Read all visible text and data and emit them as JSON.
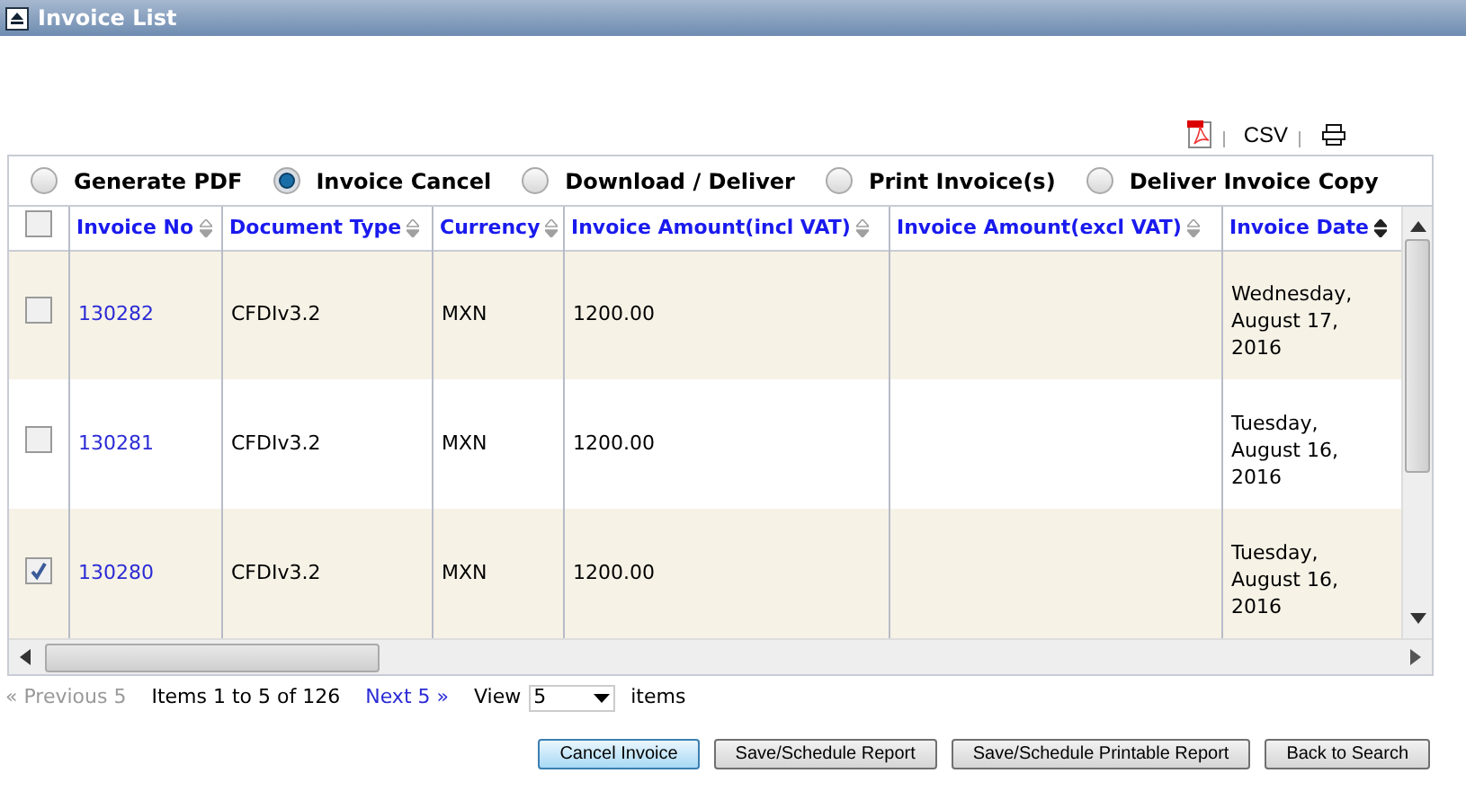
{
  "window": {
    "title": "Invoice List"
  },
  "export": [
    "CSV"
  ],
  "actions": [
    {
      "label": "Generate PDF",
      "selected": false
    },
    {
      "label": "Invoice Cancel",
      "selected": true
    },
    {
      "label": "Download / Deliver",
      "selected": false
    },
    {
      "label": "Print Invoice(s)",
      "selected": false
    },
    {
      "label": "Deliver Invoice Copy",
      "selected": false
    }
  ],
  "table": {
    "select_all": {
      "checked": false
    },
    "columns": [
      {
        "label": "Invoice No",
        "sorted": false
      },
      {
        "label": "Document Type",
        "sorted": false
      },
      {
        "label": "Currency",
        "sorted": false
      },
      {
        "label": "Invoice Amount(incl VAT)",
        "sorted": false
      },
      {
        "label": "Invoice Amount(excl VAT)",
        "sorted": false
      },
      {
        "label": "Invoice Date",
        "sorted": true
      }
    ],
    "rows": [
      {
        "checked": false,
        "cells": [
          "130282",
          "CFDIv3.2",
          "MXN",
          "1200.00",
          "",
          "Wednesday, August 17, 2016"
        ]
      },
      {
        "checked": false,
        "cells": [
          "130281",
          "CFDIv3.2",
          "MXN",
          "1200.00",
          "",
          "Tuesday, August 16, 2016"
        ]
      },
      {
        "checked": true,
        "cells": [
          "130280",
          "CFDIv3.2",
          "MXN",
          "1200.00",
          "",
          "Tuesday, August 16, 2016"
        ]
      }
    ]
  },
  "pagination": {
    "previous": "« Previous 5",
    "summary": "Items 1 to 5 of 126",
    "next": "Next 5 »",
    "view_label": "View",
    "view_value": "5",
    "items_label": "items"
  },
  "buttons": [
    {
      "label": "Cancel Invoice",
      "primary": true
    },
    {
      "label": "Save/Schedule Report",
      "primary": false
    },
    {
      "label": "Save/Schedule Printable Report",
      "primary": false
    },
    {
      "label": "Back to Search",
      "primary": false
    }
  ]
}
